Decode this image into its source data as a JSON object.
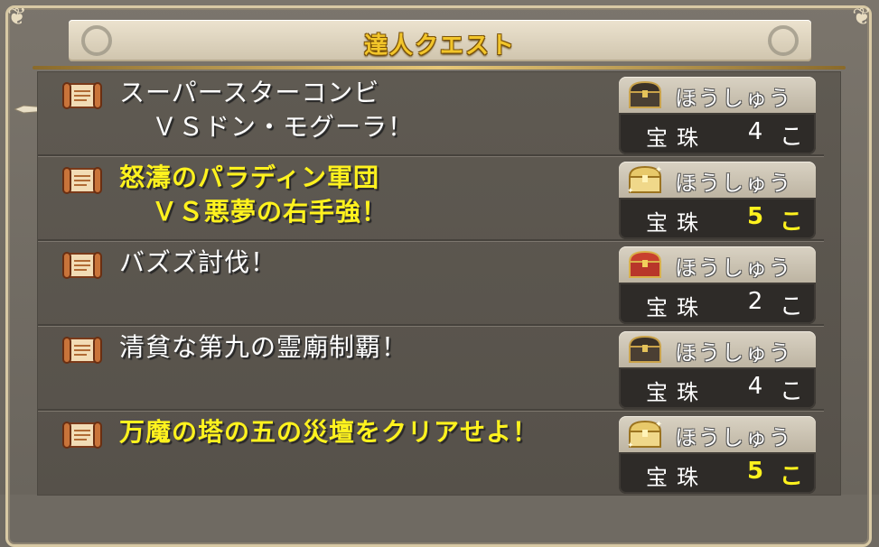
{
  "header": {
    "title": "達人クエスト"
  },
  "quests": [
    {
      "title_line1": "スーパースターコンビ",
      "title_line2": "ＶＳドン・モグーラ！",
      "highlighted": false,
      "reward": {
        "label": "ほうしゅう",
        "chest": "dark-chest-icon",
        "item": "宝珠",
        "count": "4",
        "unit": "こ"
      }
    },
    {
      "title_line1": "怒濤のパラディン軍団",
      "title_line2": "ＶＳ悪夢の右手強！",
      "highlighted": true,
      "reward": {
        "label": "ほうしゅう",
        "chest": "gold-chest-icon",
        "item": "宝珠",
        "count": "5",
        "unit": "こ"
      }
    },
    {
      "title_line1": "バズズ討伐！",
      "title_line2": "",
      "highlighted": false,
      "reward": {
        "label": "ほうしゅう",
        "chest": "red-chest-icon",
        "item": "宝珠",
        "count": "2",
        "unit": "こ"
      }
    },
    {
      "title_line1": "清貧な第九の霊廟制覇！",
      "title_line2": "",
      "highlighted": false,
      "reward": {
        "label": "ほうしゅう",
        "chest": "dark-chest-icon",
        "item": "宝珠",
        "count": "4",
        "unit": "こ"
      }
    },
    {
      "title_line1": "万魔の塔の五の災壇をクリアせよ！",
      "title_line2": "",
      "highlighted": true,
      "reward": {
        "label": "ほうしゅう",
        "chest": "gold-chest-icon",
        "item": "宝珠",
        "count": "5",
        "unit": "こ"
      }
    }
  ],
  "colors": {
    "highlight_text": "#fff21e",
    "normal_text": "#ffffff",
    "title_gold": "#f2c52a"
  }
}
